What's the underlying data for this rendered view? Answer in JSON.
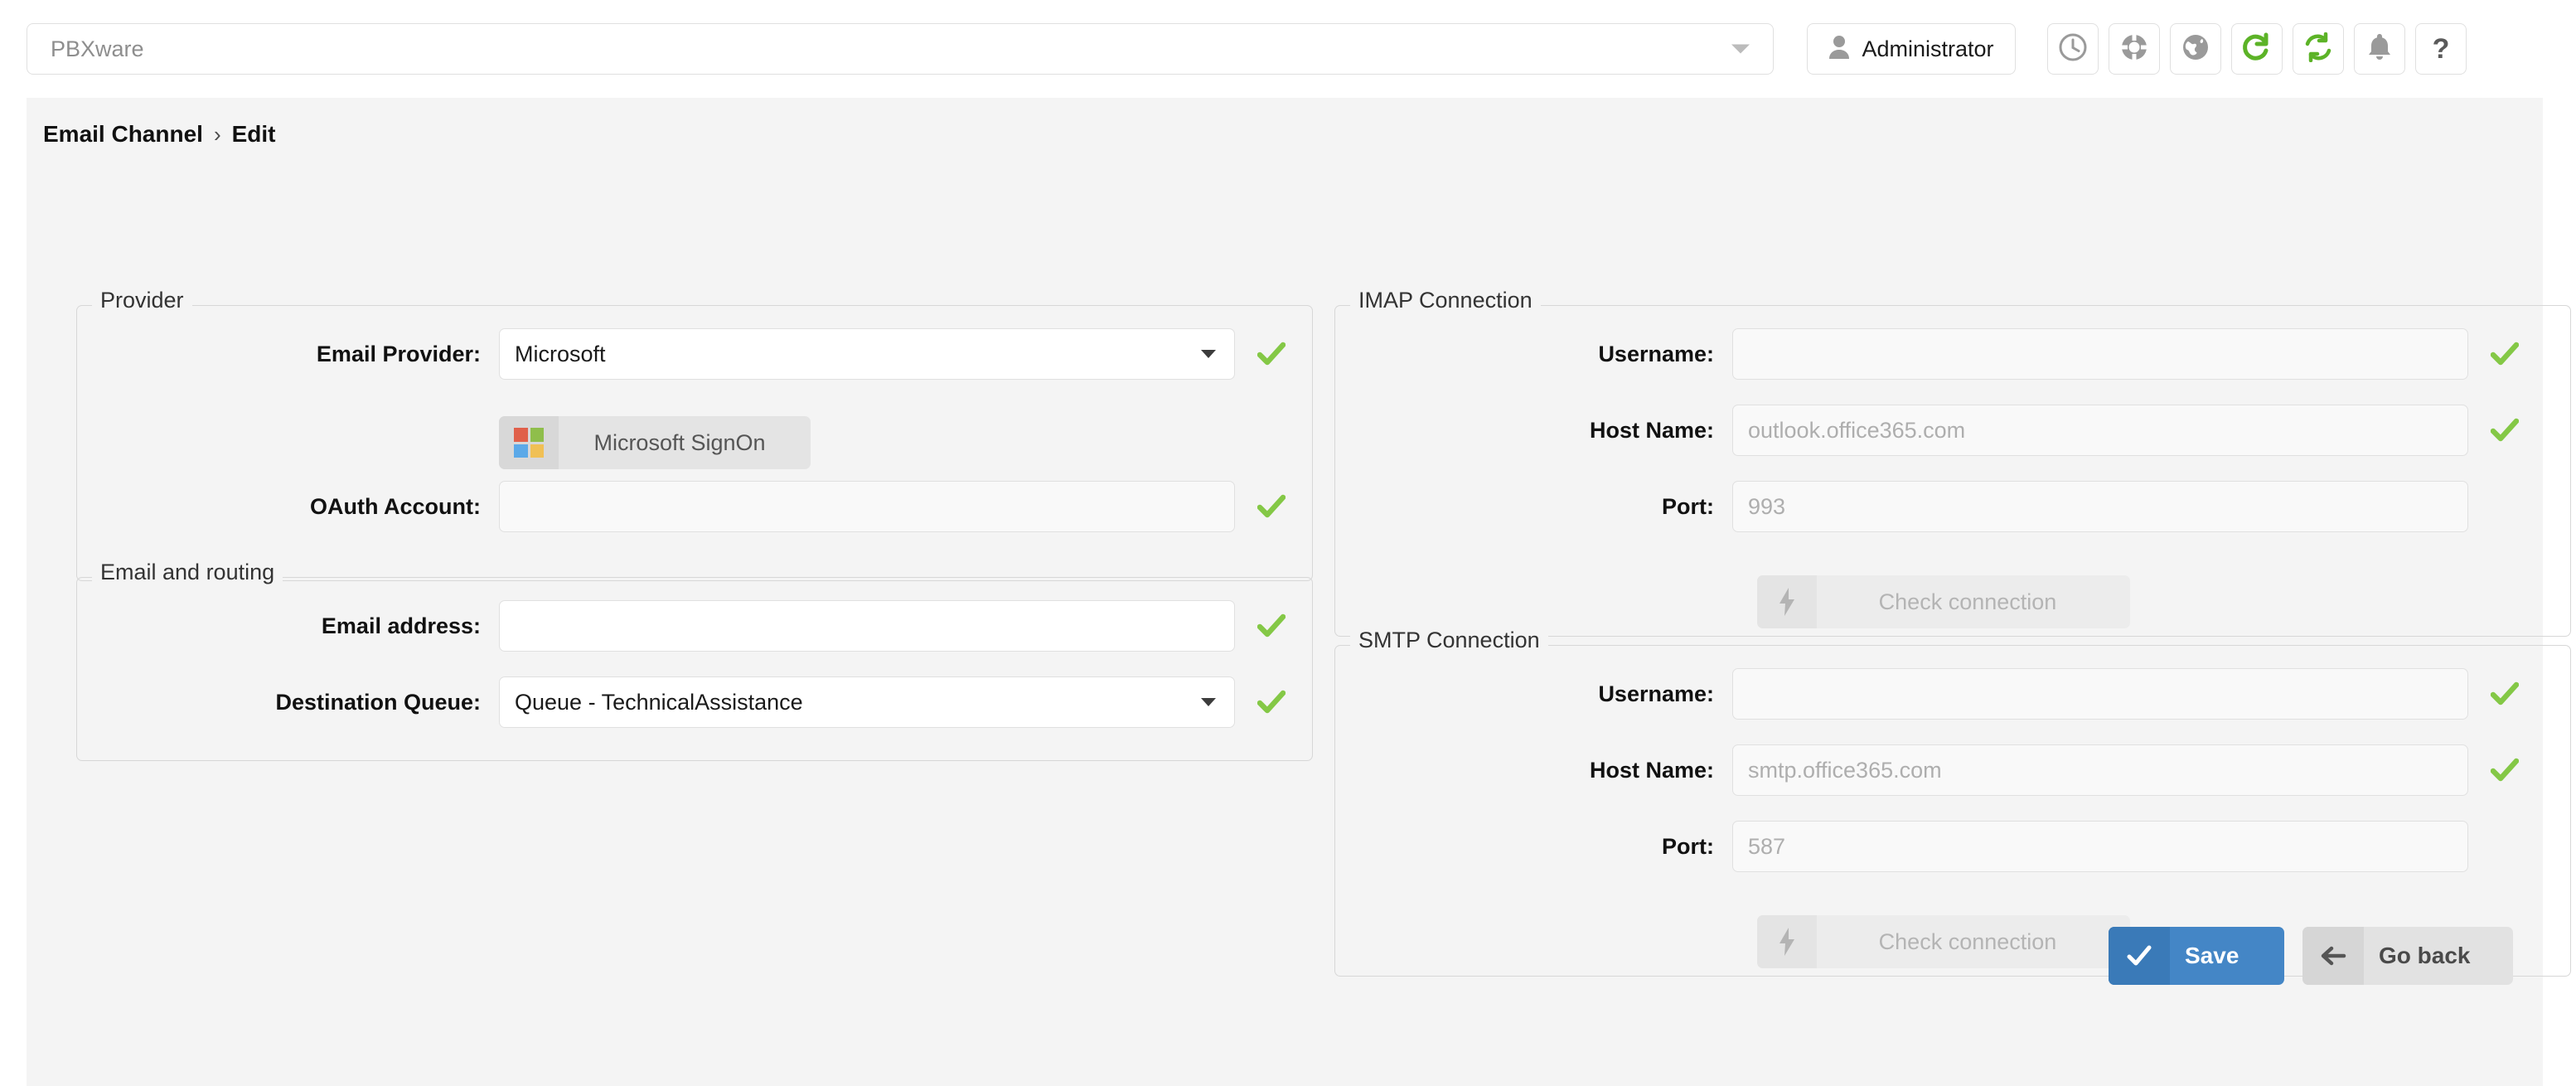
{
  "topbar": {
    "server_selector": {
      "value": "PBXware",
      "caret_icon": "chevron-down-icon"
    },
    "user_button": {
      "label": "Administrator",
      "icon": "user-icon"
    },
    "icons": [
      {
        "name": "clock-icon",
        "glyph": "clock"
      },
      {
        "name": "lifebuoy-icon",
        "glyph": "lifebuoy"
      },
      {
        "name": "globe-icon",
        "glyph": "globe"
      },
      {
        "name": "reload-icon",
        "glyph": "reload",
        "color": "#5cb327"
      },
      {
        "name": "sync-icon",
        "glyph": "sync",
        "color": "#5cb327"
      },
      {
        "name": "bell-icon",
        "glyph": "bell"
      },
      {
        "name": "help-icon",
        "glyph": "?"
      }
    ]
  },
  "breadcrumb": {
    "root": "Email Channel",
    "separator": "›",
    "current": "Edit"
  },
  "provider": {
    "legend": "Provider",
    "email_provider": {
      "label": "Email Provider:",
      "value": "Microsoft",
      "valid": true
    },
    "signon_button": {
      "label": "Microsoft SignOn",
      "icon": "microsoft-logo-icon",
      "logo_colors": [
        "#e0604a",
        "#8fbe4b",
        "#5ba9e8",
        "#f0c055"
      ]
    },
    "oauth_account": {
      "label": "OAuth Account:",
      "value": "",
      "valid": true
    }
  },
  "routing": {
    "legend": "Email and routing",
    "email_address": {
      "label": "Email address:",
      "value": "",
      "valid": true
    },
    "destination_queue": {
      "label": "Destination Queue:",
      "value": "Queue - TechnicalAssistance",
      "valid": true
    }
  },
  "imap": {
    "legend": "IMAP Connection",
    "username": {
      "label": "Username:",
      "value": "",
      "placeholder": "",
      "valid": true
    },
    "host_name": {
      "label": "Host Name:",
      "value": "",
      "placeholder": "outlook.office365.com",
      "valid": true
    },
    "port": {
      "label": "Port:",
      "value": "",
      "placeholder": "993",
      "valid": false
    },
    "check_connection": {
      "label": "Check connection",
      "icon": "bolt-icon",
      "disabled": true
    }
  },
  "smtp": {
    "legend": "SMTP Connection",
    "username": {
      "label": "Username:",
      "value": "",
      "placeholder": "",
      "valid": true
    },
    "host_name": {
      "label": "Host Name:",
      "value": "",
      "placeholder": "smtp.office365.com",
      "valid": true
    },
    "port": {
      "label": "Port:",
      "value": "",
      "placeholder": "587",
      "valid": false
    },
    "check_connection": {
      "label": "Check connection",
      "icon": "bolt-icon",
      "disabled": true
    }
  },
  "footer": {
    "save": {
      "label": "Save",
      "icon": "check-icon",
      "color": "#4486c6"
    },
    "go_back": {
      "label": "Go back",
      "icon": "arrow-left-icon",
      "color": "#e2e2e2"
    }
  },
  "colors": {
    "valid_check": "#84c846",
    "accent_blue": "#4486c6",
    "page_bg": "#f4f4f4"
  }
}
